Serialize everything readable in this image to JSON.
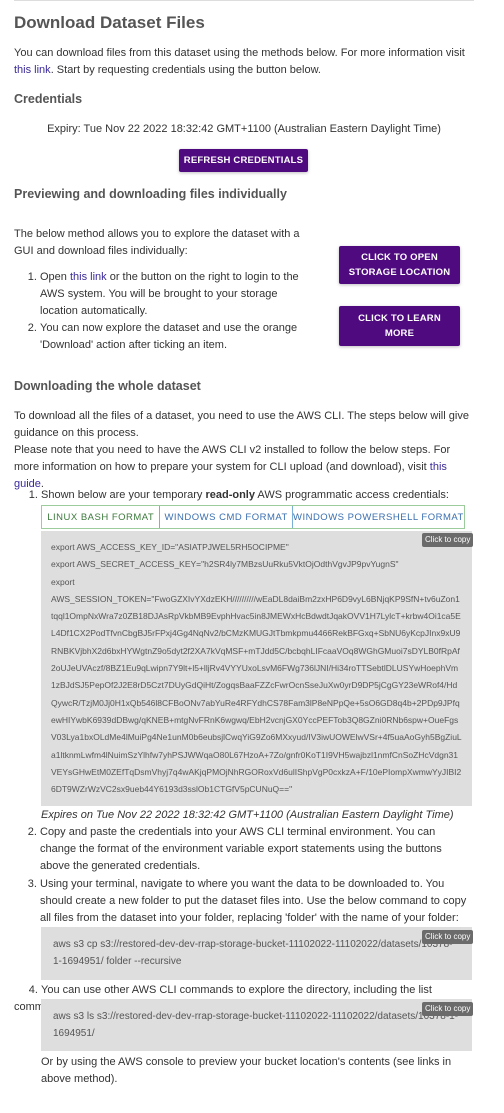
{
  "page_title": "Download Dataset Files",
  "intro": {
    "text_before_link": "You can download files from this dataset using the methods below. For more information visit ",
    "link_text": "this link",
    "text_after_link": ". Start by requesting credentials using the button below."
  },
  "credentials": {
    "heading": "Credentials",
    "expiry": "Expiry: Tue Nov 22 2022 18:32:42 GMT+1100 (Australian Eastern Daylight Time)",
    "refresh_button": "Refresh Credentials"
  },
  "preview": {
    "heading": "Previewing and downloading files individually",
    "description": "The below method allows you to explore the dataset with a GUI and download files individually:",
    "step1_open": "Open ",
    "step1_link": "this link",
    "step1_rest": " or the button on the right to login to the AWS system. You will be brought to your storage location automatically.",
    "step2": "You can now explore the dataset and use the orange 'Download' action after ticking an item.",
    "open_storage_button": "Click to Open Storage Location",
    "learn_more_button": "Click to Learn More"
  },
  "whole": {
    "heading": "Downloading the whole dataset",
    "para1": "To download all the files of a dataset, you need to use the AWS CLI. The steps below will give guidance on this process.",
    "para2_before": "Please note that you need to have the AWS CLI v2 installed to follow the below steps. For more information on how to prepare your system for CLI upload (and download), visit ",
    "para2_link": "this guide",
    "para2_after": ".",
    "step1_before": "Shown below are your temporary ",
    "step1_bold": "read-only",
    "step1_after": " AWS programmatic access credentials:",
    "tabs": [
      "Linux Bash Format",
      "Windows CMD Format",
      "Windows Powershell Format"
    ],
    "copy_label": "Click to copy",
    "cred_lines": [
      "export AWS_ACCESS_KEY_ID=\"ASIATPJWEL5RH5OCIPME\"",
      "export AWS_SECRET_ACCESS_KEY=\"h2SR4ly7MBzsUuRku5VktOjOdthVgvJP9pvYugnS\"",
      "export",
      "AWS_SESSION_TOKEN=\"FwoGZXIvYXdzEKH//////////wEaDL8daiBm2zxHP6D9vyL6BNjqKP9SfN+tv6uZon1tqql1OmpNxWra7z0ZB18DJAsRpVkbMB9EvphHvac5in8JMEWxHcBdwdtJqakOVV1H7LylcT+krbw4Oi1ca5EL4Df1CX2PodTfvnCbgBJ5rFPxj4Gg4NqNv2/bCMzKMUGJtTbmkpmu4466RekBFGxq+SbNU6yKcpJInx9xU9RNBKVjbhX2d6bxHYWgtnZ9o5dyt2f2XA7kVqMSF+mTJdd5C/bcbqhLIFcaaVOq8WGhGMuoi7sDYLB0fRpAf2oUJeUVAczf/8BZ1Eu9qLwipn7Y9lt+l5+lljRv4VYYUxoLsvM6FWg736lJNI/Hi34roTTSebtlDLUSYwHoephVm1zBJdSJ5PepOf2J2E8rD5Czt7DUyGdQiHt/ZogqsBaaFZZcFwrOcnSseJuXw0yrD9DP5jCgGY23eWRof4/HdQywcR/TzjM0Jj0H1xQb546l8CFBoONv7abYuRe4RFYdhCS78Fam3lP8eNPpQe+5sO6GD8q4b+2PDp9JPfqewHIYwbK6939dDBwg/qKNEB+mtgNvFRnK6wgwq/EbH2vcnjGX0YccPEFTob3Q8GZni0RNb6spw+OueFgsV03Lya1bxOLdMe4lMuiPg4Ne1unM0b6eubsjlCwqYiG9Zo6MXxyud/IV3iwUOWElwVSr+4f5uaAoGyh5BgZiuLa1ltknmLwfm4lNuimSzYlhfw7yhPSJWWqaO80L67HzoA+7Zo/gnfr0KoT1I9VH5wajbzl1nmfCnSoZHcVdgn31VEYsGHwEtM0ZEfTqDsmVhyj7q4wAKjqPMOjNhRGORoxVd6ulIShpVgP0cxkzA+F/10ePIompXwmwYyJIBI26DT9WZrWzVC2sx9ueb44Y6193d3sslOb1CTGfV5pCUNuQ==\""
    ],
    "expires": "Expires on Tue Nov 22 2022 18:32:42 GMT+1100 (Australian Eastern Daylight Time)",
    "step2": "Copy and paste the credentials into your AWS CLI terminal environment. You can change the format of the environment variable export statements using the buttons above the generated credentials.",
    "step3": "Using your terminal, navigate to where you want the data to be downloaded to. You should create a new folder to put the dataset files into. Use the below command to copy all files from the dataset into your folder, replacing 'folder' with the name of your folder:",
    "cmd_copy": "aws s3 cp s3://restored-dev-dev-rrap-storage-bucket-11102022-11102022/datasets/10378-1-1694951/ folder --recursive",
    "step4": "You can use other AWS CLI commands to explore the directory, including the list command:",
    "cmd_list": "aws s3 ls s3://restored-dev-dev-rrap-storage-bucket-11102022-11102022/datasets/10378-1-1694951/",
    "outro": "Or by using the AWS console to preview your bucket location's contents (see links in above method)."
  }
}
